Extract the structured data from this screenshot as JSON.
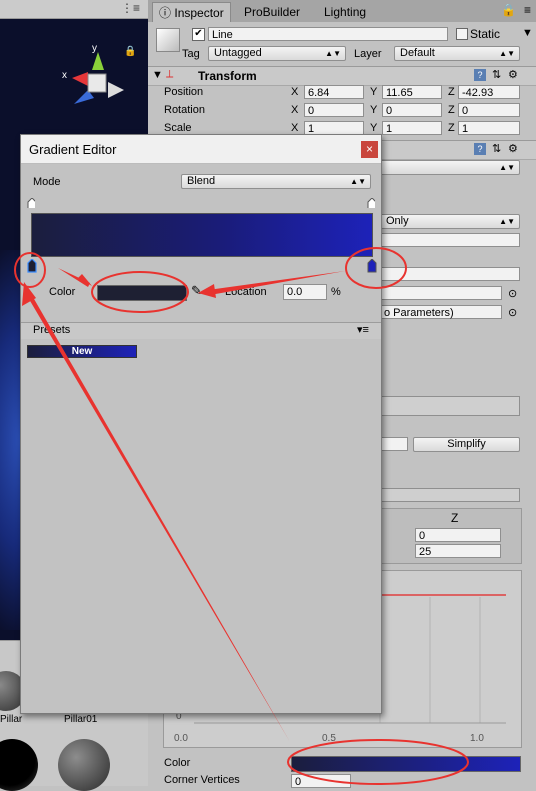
{
  "tabs": [
    {
      "label": "Inspector"
    },
    {
      "label": "ProBuilder"
    },
    {
      "label": "Lighting"
    }
  ],
  "gameobject": {
    "name": "Line",
    "static_label": "Static",
    "tag_label": "Tag",
    "tag_value": "Untagged",
    "layer_label": "Layer",
    "layer_value": "Default"
  },
  "transform": {
    "title": "Transform",
    "position_label": "Position",
    "rotation_label": "Rotation",
    "scale_label": "Scale",
    "axis_x": "X",
    "axis_y": "Y",
    "axis_z": "Z",
    "position": {
      "x": "6.84",
      "y": "11.65",
      "z": "-42.93"
    },
    "rotation": {
      "x": "0",
      "y": "0",
      "z": "0"
    },
    "scale": {
      "x": "1",
      "y": "1",
      "z": "1"
    }
  },
  "line_renderer": {
    "only_dropdown": "Only",
    "parameters_field": "o Parameters)",
    "simplify_button": "Simplify",
    "z_header": "Z",
    "z_values": [
      "0",
      "25"
    ],
    "curve_ticks": {
      "left_zero": "0",
      "x0": "0.0",
      "x05": "0.5",
      "x1": "1.0"
    },
    "color_label": "Color",
    "corner_vertices_label": "Corner Vertices",
    "corner_vertices_value": "0"
  },
  "gradient_editor": {
    "title": "Gradient Editor",
    "close_glyph": "×",
    "mode_label": "Mode",
    "mode_value": "Blend",
    "color_label": "Color",
    "location_label": "Location",
    "location_value": "0.0",
    "location_unit": "%",
    "presets_label": "Presets",
    "new_preset_label": "New",
    "gradient_colors": [
      "#1b1e3d",
      "#1d22b9"
    ],
    "selected_color": "#1e2033"
  },
  "scene": {
    "gizmo_axes": {
      "x": "x",
      "y": "y"
    },
    "assets": [
      {
        "label": "Pillar"
      },
      {
        "label": "Pillar01"
      }
    ]
  },
  "annotation_color": "#e8332f"
}
